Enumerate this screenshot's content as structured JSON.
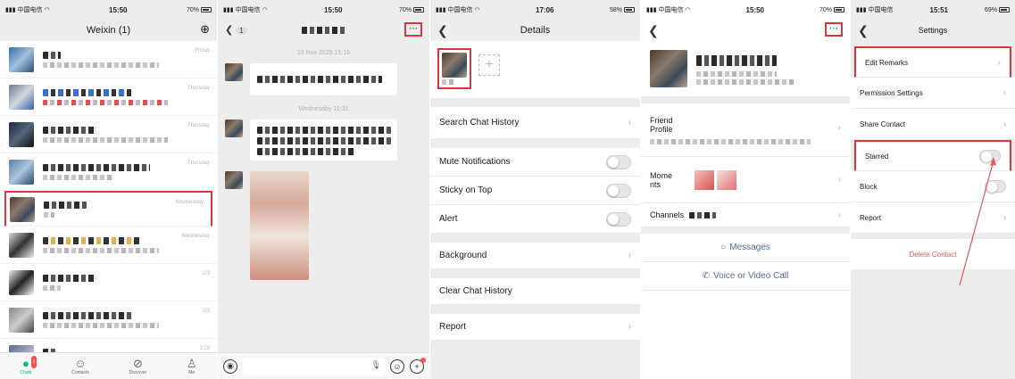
{
  "panel1": {
    "status": {
      "carrier": "中国电信",
      "time": "15:50",
      "battery": "70%"
    },
    "title": "Weixin (1)",
    "add_icon": "plus-circle-icon",
    "chats": [
      {
        "time": "Friday"
      },
      {
        "time": "Thursday"
      },
      {
        "time": "Thursday"
      },
      {
        "time": "Thursday"
      },
      {
        "time": "Wednesday"
      },
      {
        "time": "Wednesday"
      },
      {
        "time": "2/3"
      },
      {
        "time": "2/3"
      },
      {
        "time": "1/28"
      }
    ],
    "tabs": [
      {
        "label": "Chats",
        "icon": "chat-bubble-icon",
        "badge": "1"
      },
      {
        "label": "Contacts",
        "icon": "contacts-icon"
      },
      {
        "label": "Discover",
        "icon": "compass-icon"
      },
      {
        "label": "Me",
        "icon": "person-icon"
      }
    ]
  },
  "panel2": {
    "status": {
      "carrier": "中国电信",
      "time": "15:50",
      "battery": "70%"
    },
    "back_count": "1",
    "more_icon": "ellipsis-icon",
    "timestamp1": "19 Nov 2025 15:16",
    "timestamp2": "Wednesday 11:31"
  },
  "panel3": {
    "status": {
      "carrier": "中国电信",
      "time": "17:06",
      "battery": "58%"
    },
    "title": "Details",
    "add_member": "+",
    "rows": {
      "search": "Search Chat History",
      "mute": "Mute Notifications",
      "sticky": "Sticky on Top",
      "alert": "Alert",
      "background": "Background",
      "clear": "Clear Chat History",
      "report": "Report"
    }
  },
  "panel4": {
    "status": {
      "carrier": "中国电信",
      "time": "15:50",
      "battery": "70%"
    },
    "friend_profile": "Friend\nProfile",
    "moments": "Mome\nnts",
    "channels": "Channels",
    "messages": "Messages",
    "voice_video": "Voice or Video Call"
  },
  "panel5": {
    "status": {
      "carrier": "中国电信",
      "time": "15:51",
      "battery": "69%"
    },
    "title": "Settings",
    "rows": {
      "edit_remarks": "Edit Remarks",
      "permission": "Permission Settings",
      "share": "Share Contact",
      "starred": "Starred",
      "block": "Block",
      "report": "Report"
    },
    "delete": "Delete Contact"
  },
  "colors": {
    "accent_green": "#07c160",
    "highlight_red": "#d9363e",
    "link_blue": "#576b95",
    "delete_red": "#e05a5a"
  }
}
